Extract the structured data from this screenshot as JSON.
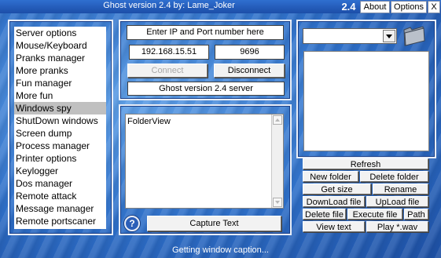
{
  "window": {
    "title": "Ghost version 2.4 by: Lame_Joker",
    "version_badge": "2.4",
    "menu": [
      "About",
      "Options",
      "X"
    ]
  },
  "sidebar": {
    "items": [
      {
        "label": "Server options"
      },
      {
        "label": "Mouse/Keyboard"
      },
      {
        "label": "Pranks manager"
      },
      {
        "label": "More pranks"
      },
      {
        "label": "Fun manager"
      },
      {
        "label": "More fun"
      },
      {
        "label": "Windows spy",
        "selected": true
      },
      {
        "label": "ShutDown windows"
      },
      {
        "label": "Screen dump"
      },
      {
        "label": "Process manager"
      },
      {
        "label": "Printer options"
      },
      {
        "label": "Keylogger"
      },
      {
        "label": "Dos manager"
      },
      {
        "label": "Remote attack"
      },
      {
        "label": "Message manager"
      },
      {
        "label": "Remote portscaner"
      }
    ]
  },
  "connection": {
    "prompt": "Enter IP and Port number here",
    "ip": "192.168.15.51",
    "port": "9696",
    "connect_label": "Connect",
    "disconnect_label": "Disconnect",
    "server_info": "Ghost version 2.4 server"
  },
  "spy": {
    "folder_view": "FolderView",
    "help_label": "?",
    "capture_label": "Capture Text"
  },
  "files": {
    "buttons": {
      "refresh": "Refresh",
      "new_folder": "New folder",
      "delete_folder": "Delete folder",
      "get_size": "Get size",
      "rename": "Rename",
      "download": "DownLoad file",
      "upload": "UpLoad file",
      "delete_file": "Delete file",
      "execute_file": "Execute file",
      "path": "Path",
      "view_text": "View text",
      "play_wav": "Play *.wav"
    }
  },
  "status": {
    "text": "Getting window caption..."
  }
}
